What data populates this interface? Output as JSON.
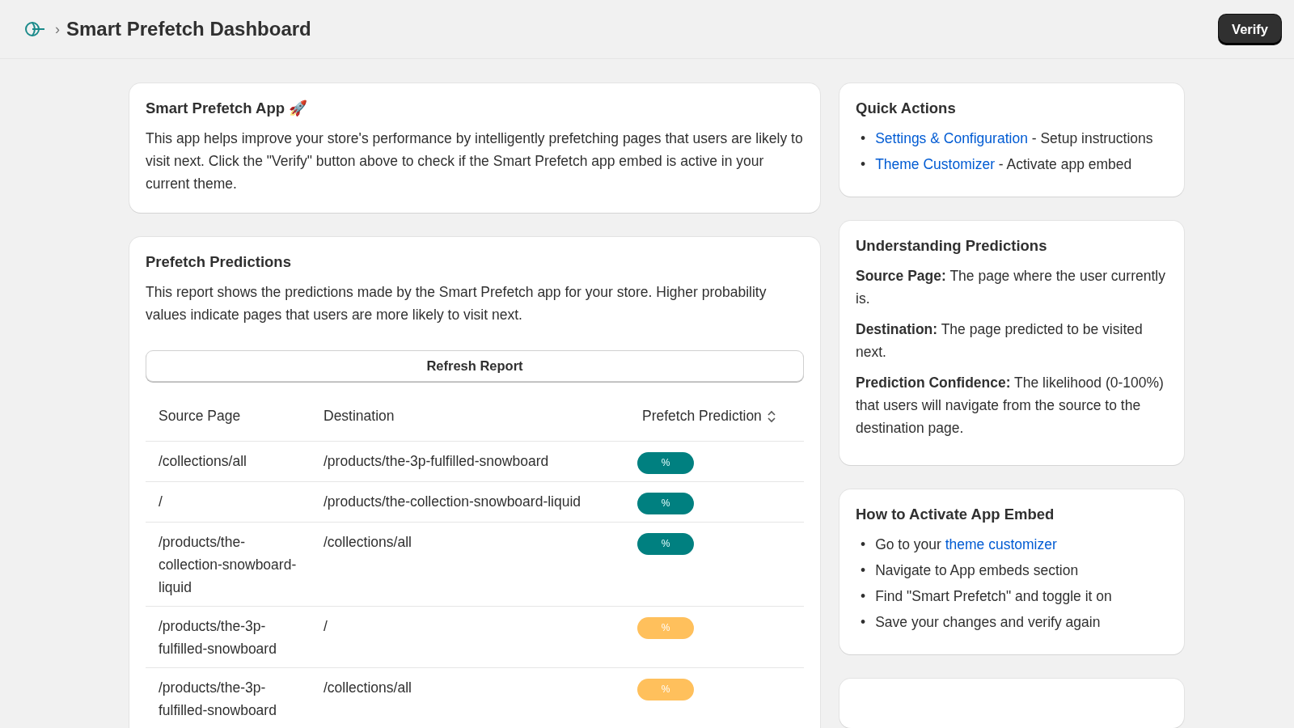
{
  "header": {
    "breadcrumb_separator": "›",
    "title": "Smart Prefetch Dashboard",
    "button": "Verify"
  },
  "app_card": {
    "title": "Smart Prefetch App 🚀",
    "text": "This app helps improve your store's performance by intelligently prefetching pages that users are likely to visit next. Click the \"Verify\" button above to check if the Smart Prefetch app embed is active in your current theme."
  },
  "predictions": {
    "title": "Prefetch Predictions",
    "text": "This report shows the predictions made by the Smart Prefetch app for your store. Higher probability values indicate pages that users are more likely to visit next.",
    "refresh_button": "Refresh Report",
    "columns": [
      "Source Page",
      "Destination",
      "Prefetch Prediction"
    ],
    "rows": [
      {
        "source": "/collections/all",
        "destination": "/products/the-3p-fulfilled-snowboard",
        "badge": "%",
        "color": "#008080"
      },
      {
        "source": "/",
        "destination": "/products/the-collection-snowboard-liquid",
        "badge": "%",
        "color": "#008080"
      },
      {
        "source": "/products/the-collection-snowboard-liquid",
        "destination": "/collections/all",
        "badge": "%",
        "color": "#008080"
      },
      {
        "source": "/products/the-3p-fulfilled-snowboard",
        "destination": "/",
        "badge": "%",
        "color": "#ffc05c"
      },
      {
        "source": "/products/the-3p-fulfilled-snowboard",
        "destination": "/collections/all",
        "badge": "%",
        "color": "#ffc05c"
      }
    ]
  },
  "quick_actions": {
    "title": "Quick Actions",
    "items": [
      {
        "bullet": "•",
        "link": "Settings & Configuration",
        "text": " - Setup instructions"
      },
      {
        "bullet": "•",
        "link": "Theme Customizer",
        "text": " - Activate app embed"
      }
    ]
  },
  "understanding": {
    "title": "Understanding Predictions",
    "paragraphs": [
      "**Source Page:** The page where the user currently is.",
      "**Destination:** The page predicted to be visited next.",
      "**Prediction Confidence:** The likelihood (0-100%) that users will navigate from the source to the destination page."
    ]
  },
  "activate": {
    "title": "How to Activate App Embed",
    "items": [
      {
        "bullet": "•",
        "text": "Go to your ",
        "link": "theme customizer"
      },
      {
        "bullet": "•",
        "text": "Navigate to App embeds section"
      },
      {
        "bullet": "•",
        "text": "Find \"Smart Prefetch\" and toggle it on"
      },
      {
        "bullet": "•",
        "text": "Save your changes and verify again"
      }
    ]
  }
}
